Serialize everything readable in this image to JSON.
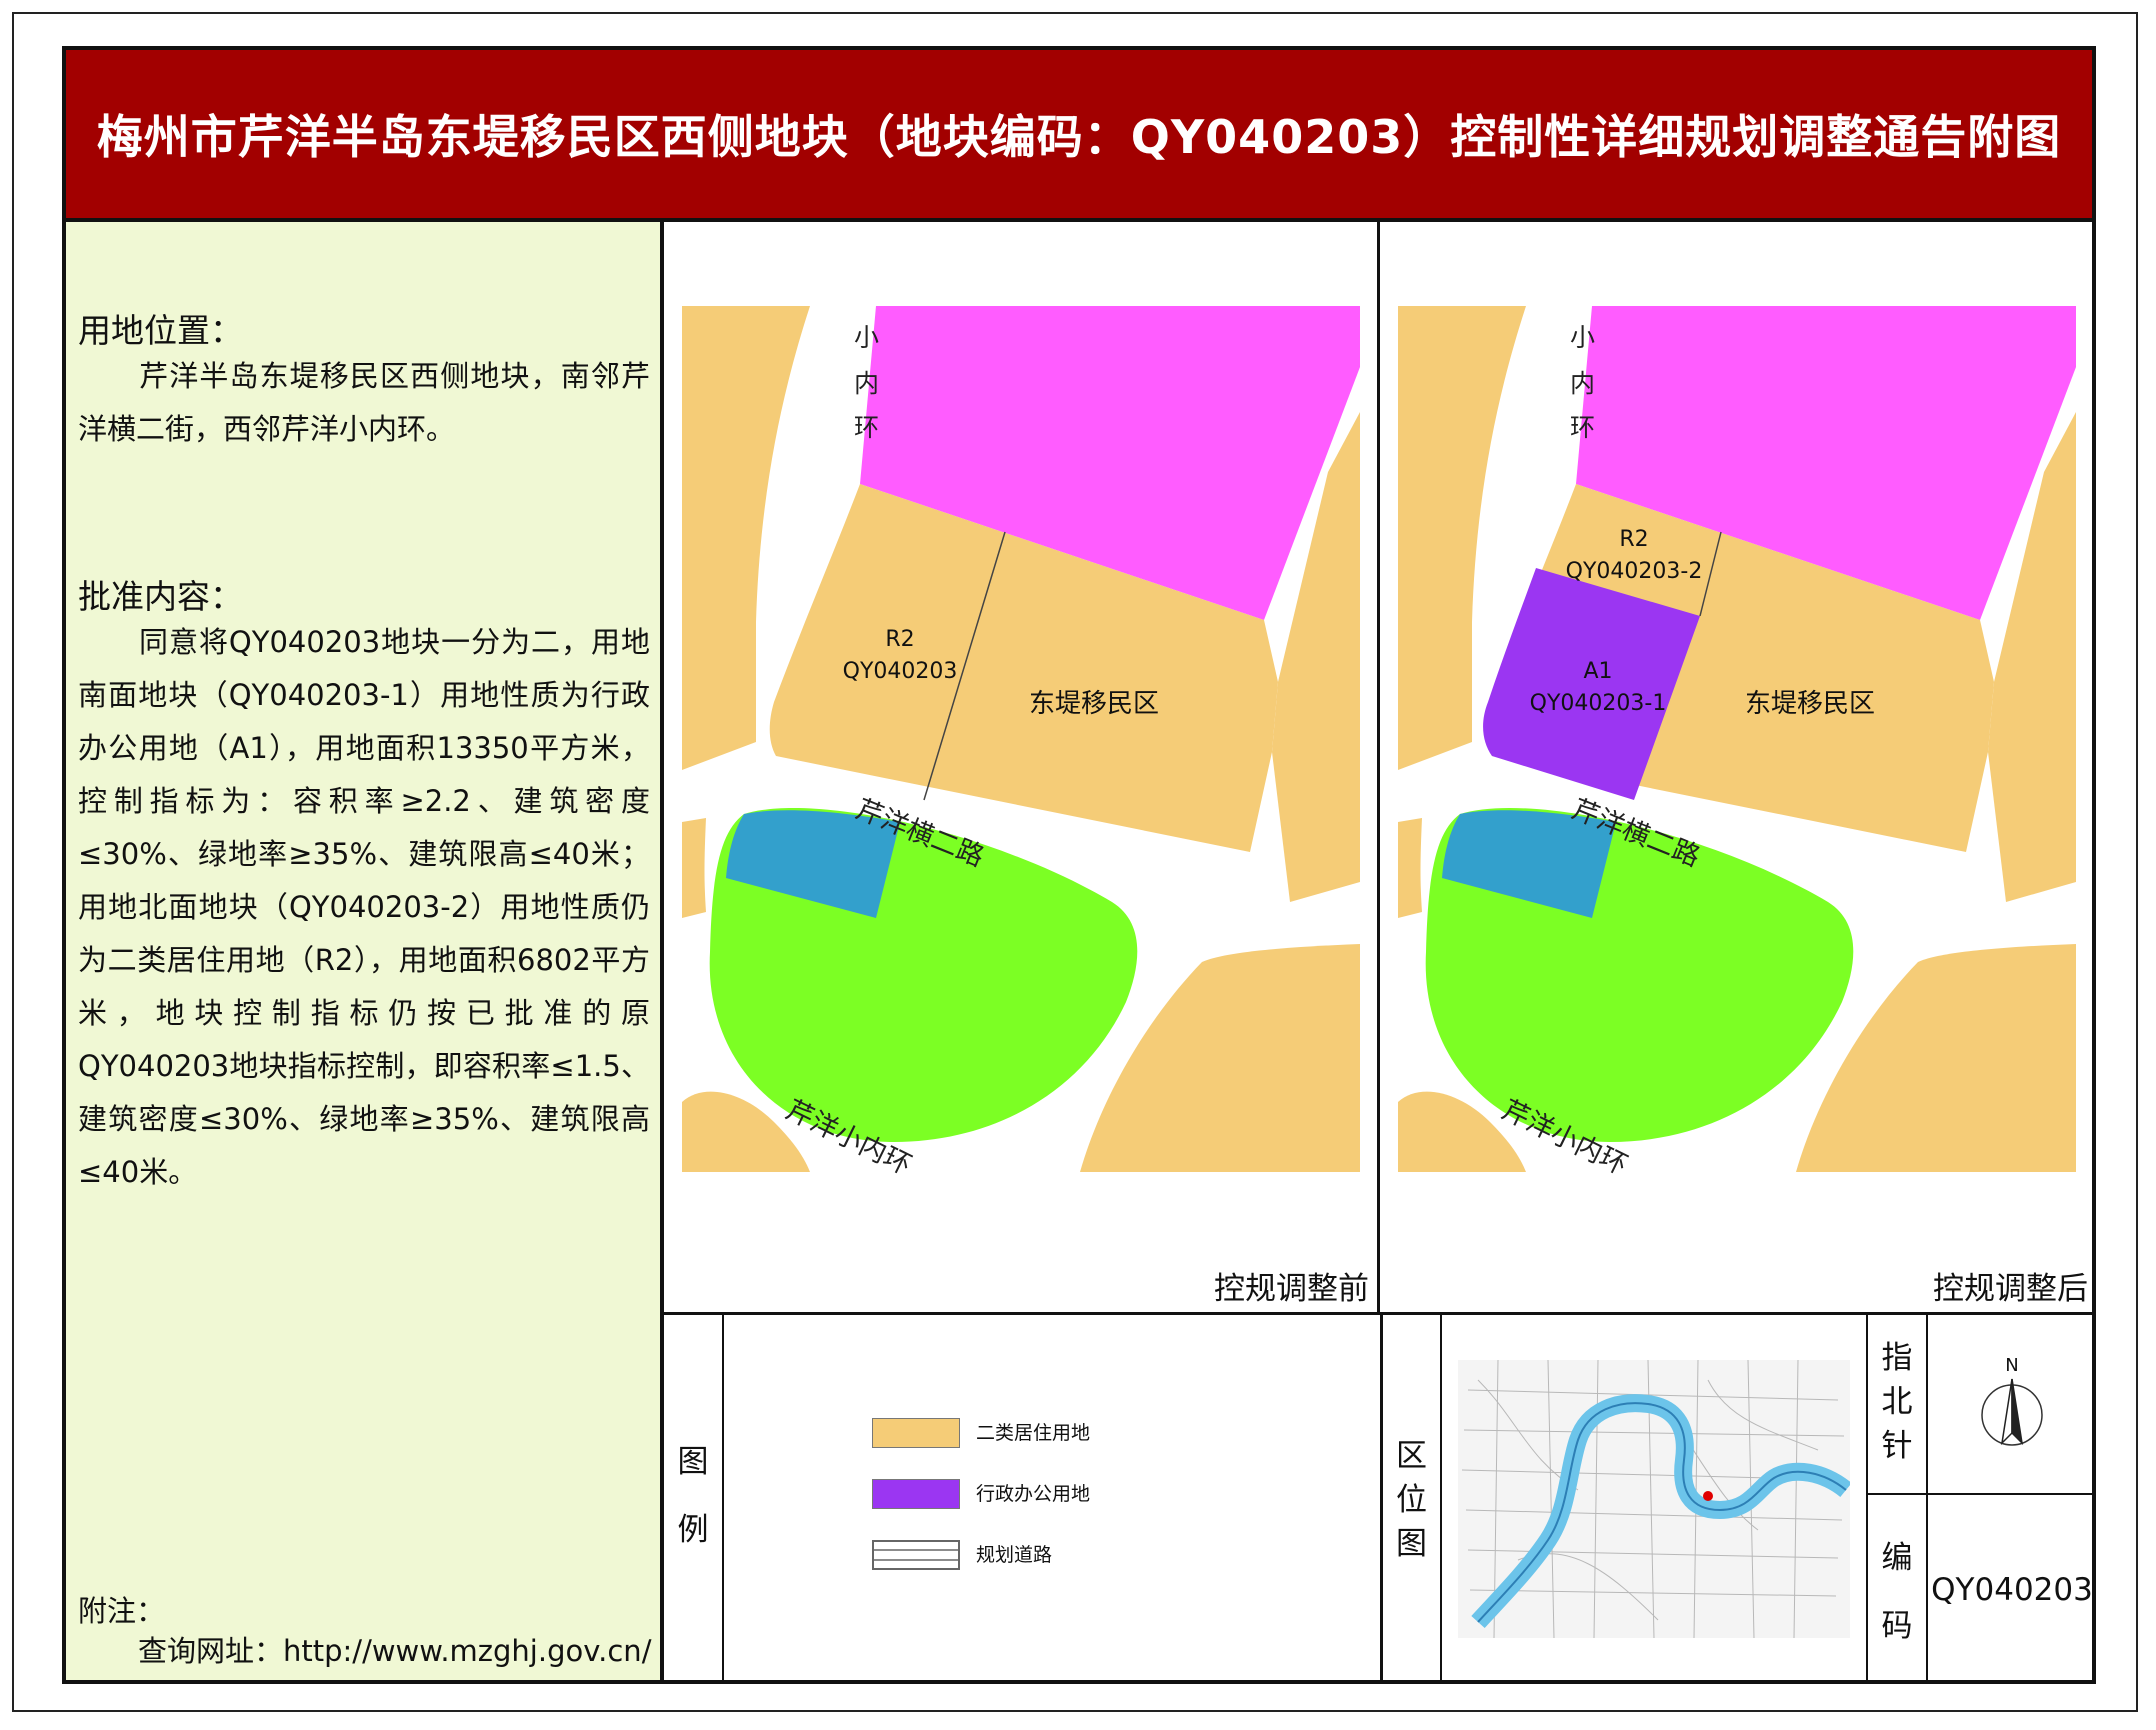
{
  "title": "梅州市芹洋半岛东堤移民区西侧地块（地块编码：QY040203）控制性详细规划调整通告附图",
  "left_panel": {
    "location_heading": "用地位置：",
    "location_text": "芹洋半岛东堤移民区西侧地块，南邻芹洋横二街，西邻芹洋小内环。",
    "approval_heading": "批准内容：",
    "approval_text": "同意将QY040203地块一分为二，用地南面地块（QY040203-1）用地性质为行政办公用地（A1），用地面积13350平方米，控制指标为：容积率≥2.2、建筑密度≤30%、绿地率≥35%、建筑限高≤40米；用地北面地块（QY040203-2）用地性质仍为二类居住用地（R2），用地面积6802平方米，地块控制指标仍按已批准的原QY040203地块指标控制，即容积率≤1.5、建筑密度≤30%、绿地率≥35%、建筑限高≤40米。",
    "note_label": "附注：",
    "note_url": "查询网址：http://www.mzghj.gov.cn/"
  },
  "map_before": {
    "caption": "控规调整前",
    "road_west_label": [
      "小",
      "内",
      "环"
    ],
    "parcel_code_r": "R2",
    "parcel_id": "QY040203",
    "district_label": "东堤移民区",
    "road_south_label": "芹洋横二路",
    "road_ring_label": "芹洋小内环"
  },
  "map_after": {
    "caption": "控规调整后",
    "road_west_label": [
      "小",
      "内",
      "环"
    ],
    "parcel_north_code": "R2",
    "parcel_north_id": "QY040203-2",
    "parcel_south_code": "A1",
    "parcel_south_id": "QY040203-1",
    "district_label": "东堤移民区",
    "road_south_label": "芹洋横二路",
    "road_ring_label": "芹洋小内环"
  },
  "legend": {
    "label": [
      "图",
      "例"
    ],
    "items": [
      {
        "label": "二类居住用地",
        "color": "#f5cc77"
      },
      {
        "label": "行政办公用地",
        "color": "#9b36f2"
      },
      {
        "label": "规划道路",
        "color": "#ffffff"
      }
    ]
  },
  "location_map": {
    "label": [
      "区",
      "位",
      "图"
    ]
  },
  "north_arrow": {
    "label": [
      "指",
      "北",
      "针"
    ],
    "north_letter": "N"
  },
  "code_block": {
    "label": [
      "编",
      "码"
    ],
    "value": "QY040203"
  },
  "colors": {
    "title_bg": "#a20000",
    "residential": "#f5cc77",
    "commercial": "#ff5cff",
    "admin_office": "#9b36f2",
    "green_space": "#7cff24",
    "blue_facility": "#33a0cc",
    "panel_bg": "#f0f8d4",
    "river": "#6cc4ea"
  }
}
